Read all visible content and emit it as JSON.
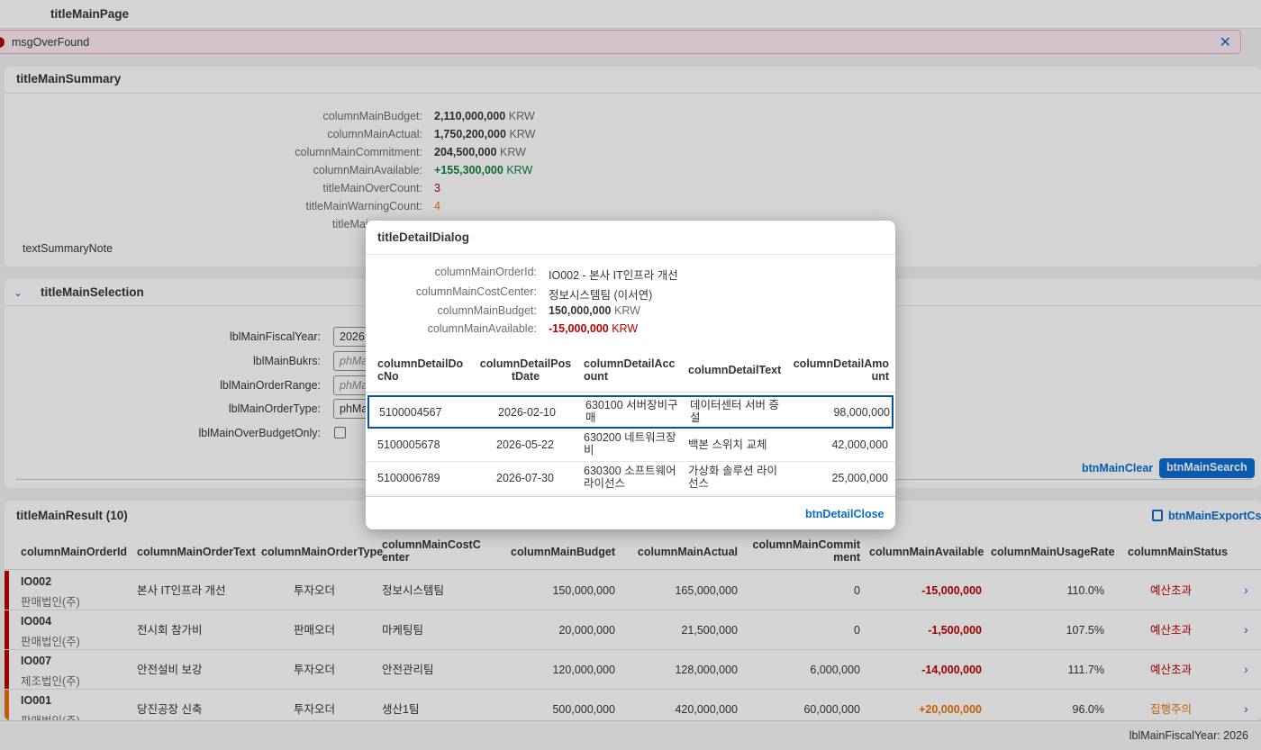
{
  "page": {
    "title": "titleMainPage"
  },
  "message": {
    "text": "msgOverFound"
  },
  "summary": {
    "title": "titleMainSummary",
    "rows": [
      {
        "label": "columnMainBudget:",
        "value": "2,110,000,000",
        "unit": "KRW"
      },
      {
        "label": "columnMainActual:",
        "value": "1,750,200,000",
        "unit": "KRW"
      },
      {
        "label": "columnMainCommitment:",
        "value": "204,500,000",
        "unit": "KRW"
      },
      {
        "label": "columnMainAvailable:",
        "value": "+155,300,000",
        "unit": "KRW"
      },
      {
        "label": "titleMainOverCount:",
        "value": "3"
      },
      {
        "label": "titleMainWarningCount:",
        "value": "4"
      },
      {
        "label": "titleMai"
      }
    ],
    "note": "textSummaryNote"
  },
  "selection": {
    "title": "titleMainSelection",
    "fields": [
      {
        "label": "lblMainFiscalYear:",
        "value": "2026"
      },
      {
        "label": "lblMainBukrs:",
        "placeholder": "phMa"
      },
      {
        "label": "lblMainOrderRange:",
        "placeholder": "phMa"
      },
      {
        "label": "lblMainOrderType:",
        "value": "phMa"
      },
      {
        "label": "lblMainOverBudgetOnly:"
      }
    ],
    "clear_label": "btnMainClear",
    "search_label": "btnMainSearch"
  },
  "result": {
    "title": "titleMainResult (10)",
    "export_label": "btnMainExportCsv",
    "columns": [
      "columnMainOrderId",
      "columnMainOrderText",
      "columnMainOrderType",
      "columnMainCostCenter",
      "columnMainBudget",
      "columnMainActual",
      "columnMainCommitment",
      "columnMainAvailable",
      "columnMainUsageRate",
      "columnMainStatus"
    ],
    "rows": [
      {
        "id": "IO002",
        "company": "판매법인(주)",
        "text": "본사 IT인프라 개선",
        "type": "투자오더",
        "cost_center": "정보시스템팀",
        "budget": "150,000,000",
        "actual": "165,000,000",
        "commitment": "0",
        "available": "-15,000,000",
        "usage": "110.0%",
        "status": "예산초과"
      },
      {
        "id": "IO004",
        "company": "판매법인(주)",
        "text": "전시회 참가비",
        "type": "판매오더",
        "cost_center": "마케팅팀",
        "budget": "20,000,000",
        "actual": "21,500,000",
        "commitment": "0",
        "available": "-1,500,000",
        "usage": "107.5%",
        "status": "예산초과"
      },
      {
        "id": "IO007",
        "company": "제조법인(주)",
        "text": "안전설비 보강",
        "type": "투자오더",
        "cost_center": "안전관리팀",
        "budget": "120,000,000",
        "actual": "128,000,000",
        "commitment": "6,000,000",
        "available": "-14,000,000",
        "usage": "111.7%",
        "status": "예산초과"
      },
      {
        "id": "IO001",
        "company": "판매법인(주)",
        "text": "당진공장 신축",
        "type": "투자오더",
        "cost_center": "생산1팀",
        "budget": "500,000,000",
        "actual": "420,000,000",
        "commitment": "60,000,000",
        "available": "+20,000,000",
        "usage": "96.0%",
        "status": "집행주의"
      }
    ]
  },
  "footer": {
    "text": "lblMainFiscalYear: 2026"
  },
  "dialog": {
    "title": "titleDetailDialog",
    "info": [
      {
        "label": "columnMainOrderId:",
        "value": "IO002 - 본사 IT인프라 개선"
      },
      {
        "label": "columnMainCostCenter:",
        "value": "정보시스템팀 (이서연)"
      },
      {
        "label": "columnMainBudget:",
        "value": "150,000,000",
        "unit": "KRW"
      },
      {
        "label": "columnMainAvailable:",
        "value": "-15,000,000",
        "unit": "KRW"
      }
    ],
    "columns": [
      "columnDetailDocNo",
      "columnDetailPostDate",
      "columnDetailAccount",
      "columnDetailText",
      "columnDetailAmount"
    ],
    "rows": [
      {
        "doc": "5100004567",
        "date": "2026-02-10",
        "account": "630100 서버장비구매",
        "text": "데이터센터 서버 증설",
        "amount": "98,000,000"
      },
      {
        "doc": "5100005678",
        "date": "2026-05-22",
        "account": "630200 네트워크장비",
        "text": "백본 스위치 교체",
        "amount": "42,000,000"
      },
      {
        "doc": "5100006789",
        "date": "2026-07-30",
        "account": "630300 소프트웨어라이선스",
        "text": "가상화 솔루션 라이선스",
        "amount": "25,000,000"
      }
    ],
    "close_label": "btnDetailClose"
  },
  "colors": {
    "accent": "#0a6ed1",
    "error": "#bb0000",
    "warning": "#e9730c",
    "positive": "#107e3e"
  }
}
